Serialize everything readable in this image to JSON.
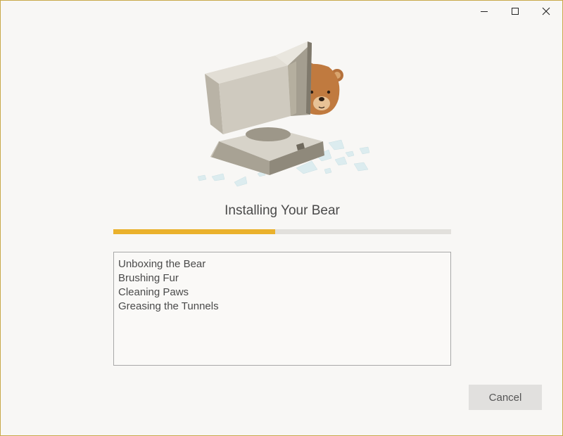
{
  "window": {
    "controls": {
      "minimize_icon": "minimize-icon",
      "maximize_icon": "maximize-icon",
      "close_icon": "close-icon"
    }
  },
  "installer": {
    "title": "Installing Your Bear",
    "progress_fraction": 0.48,
    "progress_color": "#eab12c",
    "log_lines": [
      "Unboxing the Bear",
      "Brushing Fur",
      "Cleaning Paws",
      "Greasing the Tunnels"
    ],
    "cancel_label": "Cancel"
  }
}
